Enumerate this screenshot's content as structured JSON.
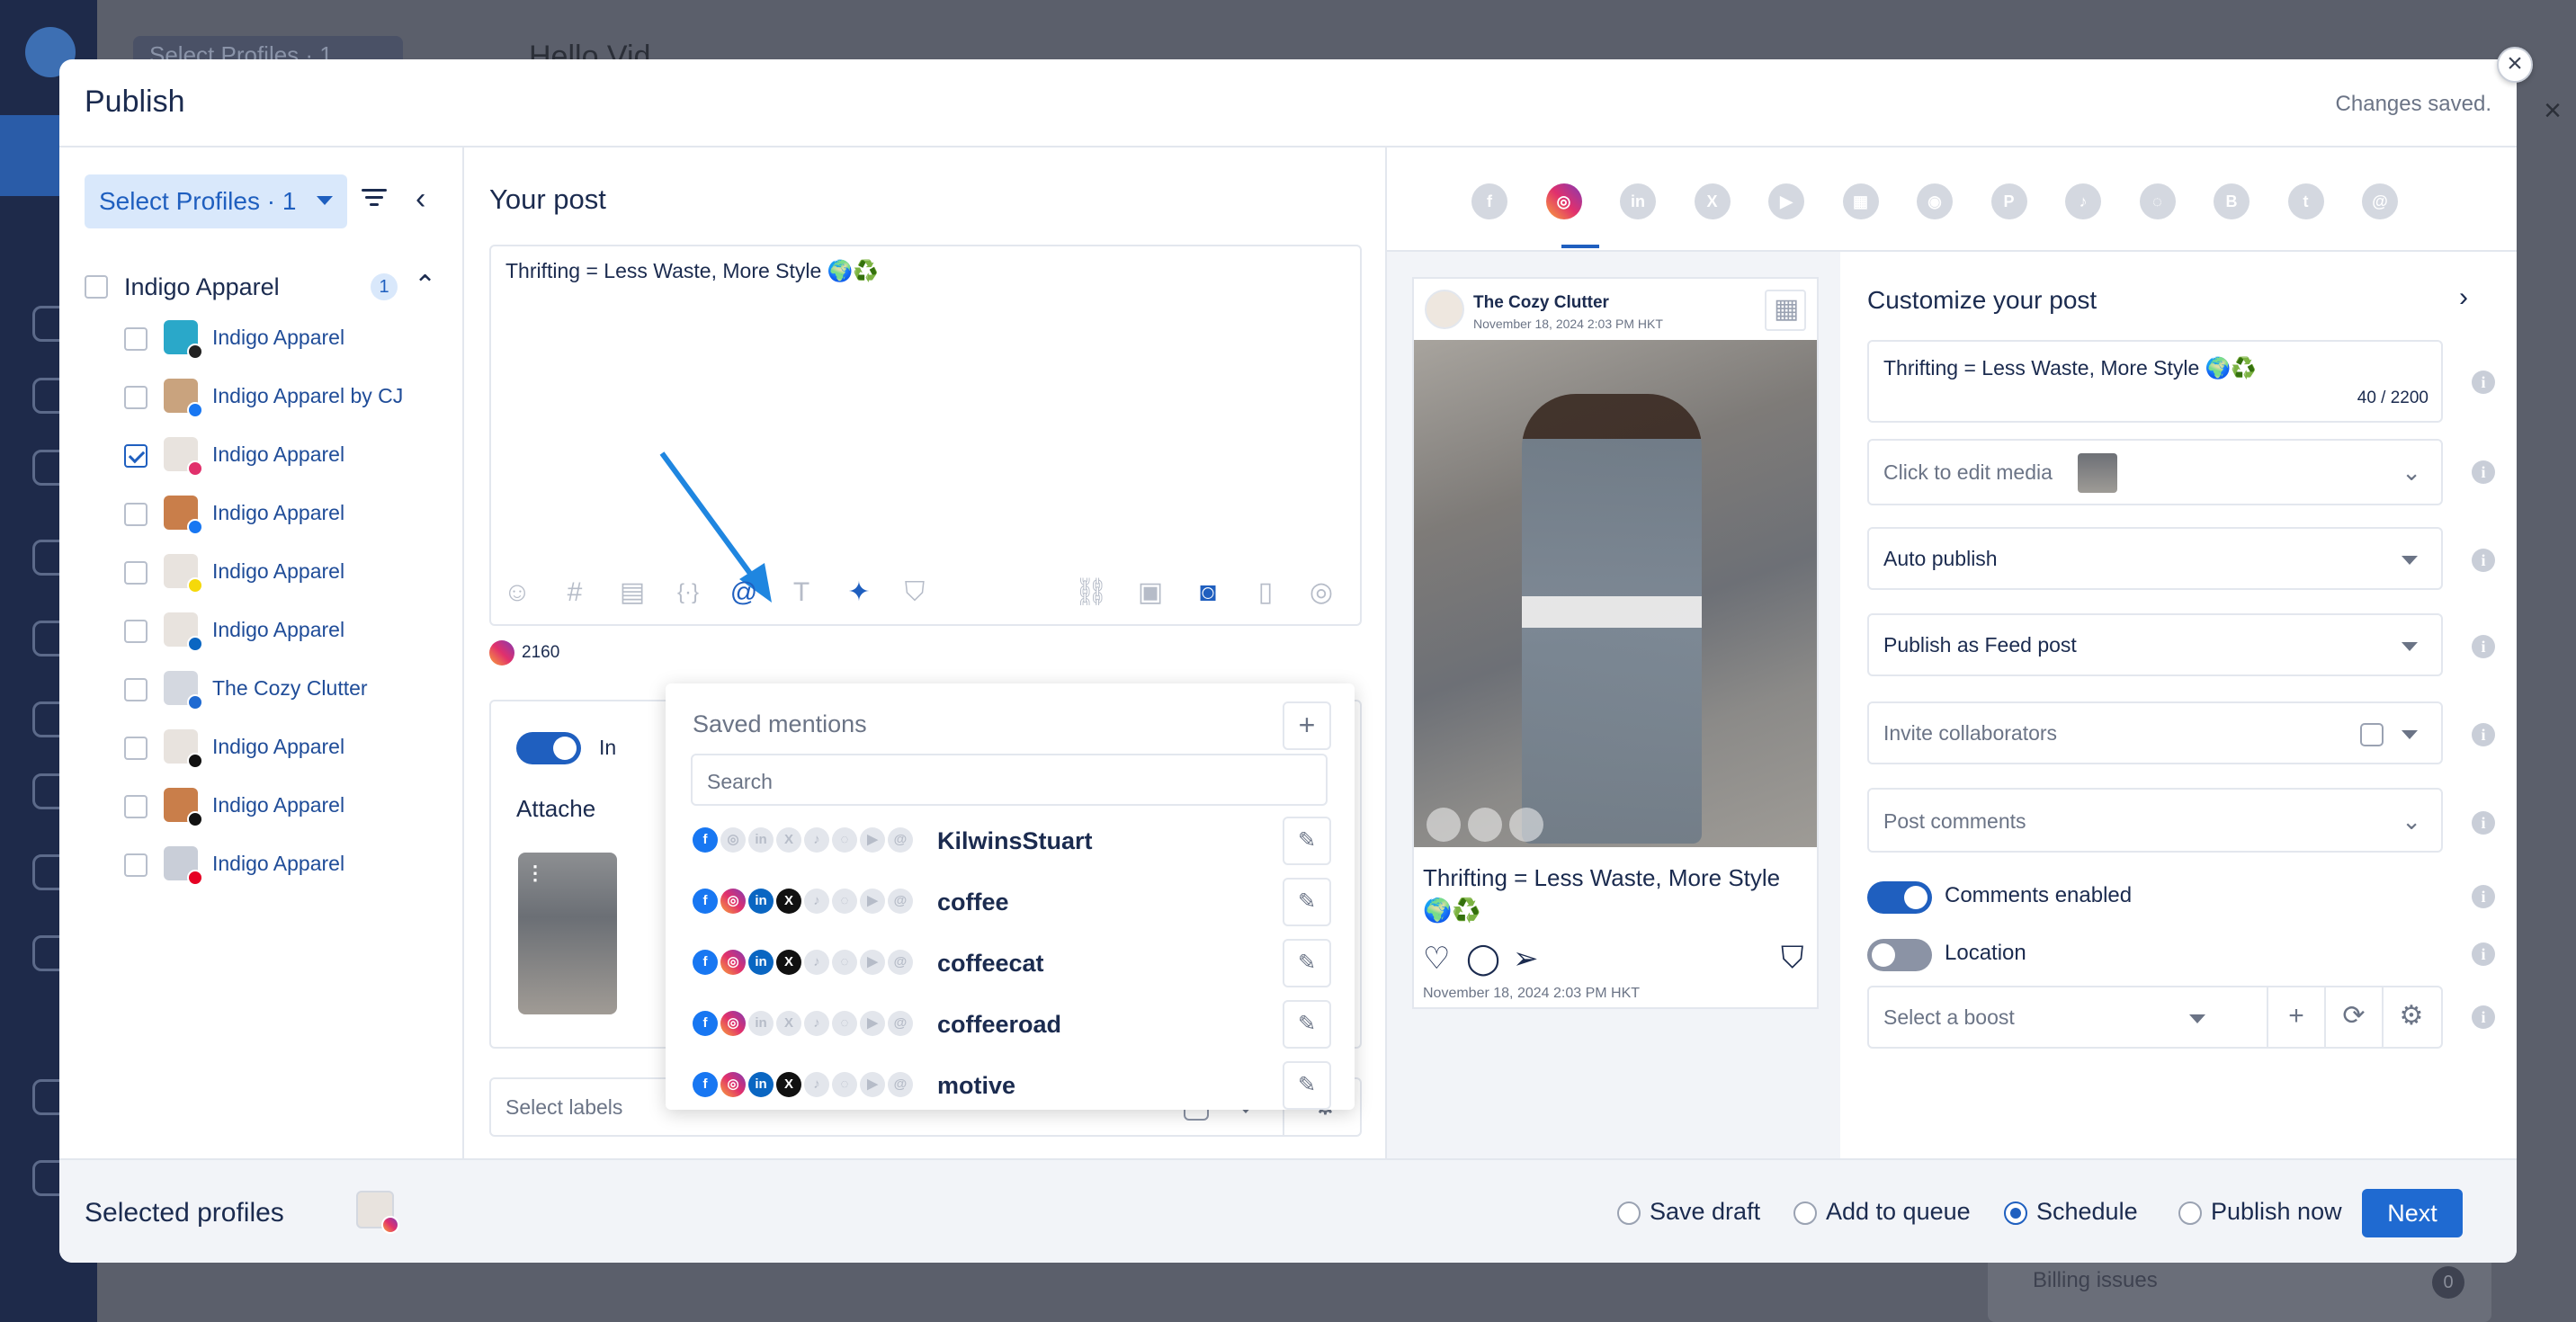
{
  "background": {
    "profiles_selector": "Select Profiles · 1",
    "greeting": "Hello Vid",
    "billing_label": "Billing issues",
    "billing_count": "0"
  },
  "modal": {
    "title": "Publish",
    "status": "Changes saved.",
    "close_glyph": "×"
  },
  "profiles_panel": {
    "select_label": "Select Profiles · 1",
    "group": {
      "name": "Indigo Apparel",
      "count": "1"
    },
    "items": [
      {
        "name": "Indigo Apparel",
        "checked": false,
        "network": "threads",
        "net_color": "#222222",
        "avatar_color": "#2aa8c9"
      },
      {
        "name": "Indigo Apparel by CJ",
        "checked": false,
        "network": "facebook",
        "net_color": "#1877f2",
        "avatar_color": "#c9a37e"
      },
      {
        "name": "Indigo Apparel",
        "checked": true,
        "network": "instagram",
        "net_color": "#e1306c",
        "avatar_color": "#e8e3de"
      },
      {
        "name": "Indigo Apparel",
        "checked": false,
        "network": "facebook",
        "net_color": "#1877f2",
        "avatar_color": "#c97e4a"
      },
      {
        "name": "Indigo Apparel",
        "checked": false,
        "network": "snapchat",
        "net_color": "#f5d90a",
        "avatar_color": "#e8e3de"
      },
      {
        "name": "Indigo Apparel",
        "checked": false,
        "network": "linkedin",
        "net_color": "#0a66c2",
        "avatar_color": "#e8e3de"
      },
      {
        "name": "The Cozy Clutter",
        "checked": false,
        "network": "google-business",
        "net_color": "#1f6ad1",
        "avatar_color": "#d4d8e0"
      },
      {
        "name": "Indigo Apparel",
        "checked": false,
        "network": "threads",
        "net_color": "#111111",
        "avatar_color": "#e8e3de"
      },
      {
        "name": "Indigo Apparel",
        "checked": false,
        "network": "tiktok",
        "net_color": "#111111",
        "avatar_color": "#c97e4a"
      },
      {
        "name": "Indigo Apparel",
        "checked": false,
        "network": "pinterest",
        "net_color": "#e60023",
        "avatar_color": "#c9ced8"
      }
    ]
  },
  "post_editor": {
    "heading": "Your post",
    "text": "Thrifting = Less Waste, More Style 🌍♻️",
    "char_count": "2160",
    "toggle_label": "In",
    "attached_label": "Attache",
    "labels_placeholder": "Select labels"
  },
  "mentions": {
    "title": "Saved mentions",
    "add_glyph": "+",
    "search_placeholder": "Search",
    "edit_glyph": "✎",
    "items": [
      {
        "name": "KilwinsStuart",
        "networks": [
          "fb"
        ]
      },
      {
        "name": "coffee",
        "networks": [
          "fb",
          "ig",
          "li",
          "x"
        ]
      },
      {
        "name": "coffeecat",
        "networks": [
          "fb",
          "ig",
          "li",
          "x"
        ]
      },
      {
        "name": "coffeeroad",
        "networks": [
          "fb",
          "ig"
        ]
      },
      {
        "name": "motive",
        "networks": [
          "fb",
          "ig",
          "li",
          "x"
        ]
      }
    ]
  },
  "preview": {
    "account_name": "The Cozy Clutter",
    "date": "November 18, 2024 2:03 PM HKT",
    "caption": "Thrifting = Less Waste, More Style 🌍♻️",
    "footer_date": "November 18, 2024 2:03 PM HKT"
  },
  "network_tabs": [
    "facebook",
    "instagram",
    "linkedin",
    "x",
    "youtube",
    "google-business",
    "reddit",
    "pinterest",
    "tiktok",
    "snapchat",
    "bluesky",
    "tumblr",
    "threads"
  ],
  "customize": {
    "title": "Customize your post",
    "caption": "Thrifting = Less Waste, More Style 🌍♻️",
    "caption_count": "40 / 2200",
    "media_label": "Click to edit media",
    "publish_mode": "Auto publish",
    "post_type": "Publish as Feed post",
    "collaborators_placeholder": "Invite collaborators",
    "comments_label": "Post comments",
    "comments_enabled_label": "Comments enabled",
    "comments_enabled": true,
    "location_label": "Location",
    "location_enabled": false,
    "boost_placeholder": "Select a boost"
  },
  "footer": {
    "selected_label": "Selected profiles",
    "options": [
      {
        "label": "Save draft",
        "checked": false
      },
      {
        "label": "Add to queue",
        "checked": false
      },
      {
        "label": "Schedule",
        "checked": true
      },
      {
        "label": "Publish now",
        "checked": false
      }
    ],
    "next_label": "Next"
  },
  "colors": {
    "accent": "#1f6ad1",
    "instagram": "#e1306c",
    "facebook": "#1877f2",
    "linkedin": "#0a66c2"
  }
}
